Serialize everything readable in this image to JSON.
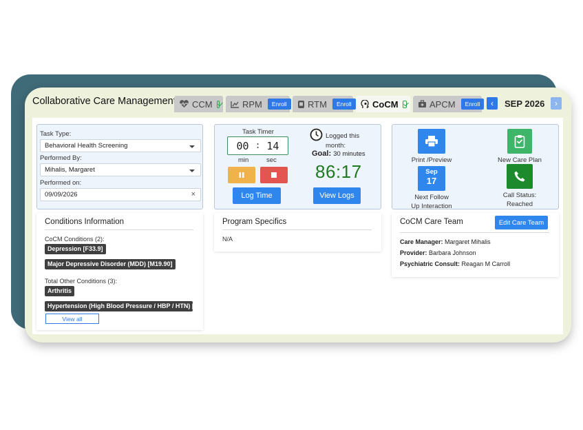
{
  "app": {
    "title": "Collaborative Care Management"
  },
  "tabs": [
    {
      "label": "CCM",
      "icon": "heartbeat-icon",
      "status": "enrolled"
    },
    {
      "label": "RPM",
      "icon": "chart-line-icon",
      "action": "Enroll"
    },
    {
      "label": "RTM",
      "icon": "device-icon",
      "action": "Enroll"
    },
    {
      "label": "CoCM",
      "icon": "head-brain-icon",
      "status": "enrolled",
      "active": true
    },
    {
      "label": "APCM",
      "icon": "medical-bag-icon",
      "action": "Enroll"
    }
  ],
  "month_nav": {
    "label": "SEP 2026",
    "prev": "‹",
    "next": "›"
  },
  "task_form": {
    "task_type_label": "Task Type:",
    "task_type_value": "Behavioral Health Screening",
    "performed_by_label": "Performed By:",
    "performed_by_value": "Mihalis, Margaret",
    "performed_on_label": "Performed on:",
    "performed_on_value": "09/09/2026",
    "clear_symbol": "×"
  },
  "timer": {
    "title": "Task Timer",
    "minutes": "00",
    "seconds": "14",
    "sep": ":",
    "min_label": "min",
    "sec_label": "sec",
    "log_time_label": "Log Time",
    "logged_line1": "Logged this",
    "logged_line2": "month:",
    "goal_label": "Goal:",
    "goal_value": "30 minutes",
    "logged_total": "86:17",
    "view_logs_label": "View Logs"
  },
  "actions": {
    "print_label": "Print /Preview",
    "new_care_plan_label": "New Care Plan",
    "follow_up_month": "Sep",
    "follow_up_day": "17",
    "follow_up_line1": "Next Follow",
    "follow_up_line2": "Up Interaction",
    "call_status_line1": "Call Status:",
    "call_status_line2": "Reached"
  },
  "conditions": {
    "title": "Conditions Information",
    "cocm_heading": "CoCM Conditions (2):",
    "cocm_items": [
      "Depression [F33.9]",
      "Major Depressive Disorder (MDD) [M19.90]"
    ],
    "other_heading": "Total Other Conditions (3):",
    "other_items": [
      "Arthritis",
      "Hypertension (High Blood Pressure / HBP / HTN) ["
    ],
    "view_all_label": "View all"
  },
  "program": {
    "title": "Program Specifics",
    "value": "N/A"
  },
  "care_team": {
    "title": "CoCM Care Team",
    "edit_label": "Edit Care Team",
    "care_manager_label": "Care Manager:",
    "care_manager_value": "Margaret Mihalis",
    "provider_label": "Provider:",
    "provider_value": "Barbara Johnson",
    "psych_label": "Psychiatric Consult:",
    "psych_value": "Reagan M Carroll"
  },
  "colors": {
    "brand_blue": "#2f86ec",
    "timer_green": "#1f7a1f",
    "pause_orange": "#f0b34b",
    "stop_red": "#e3554f",
    "new_plan_green": "#3fb56a",
    "call_green": "#1e8a2e",
    "card_back": "#3f6a78",
    "card_front": "#eef2dc"
  }
}
